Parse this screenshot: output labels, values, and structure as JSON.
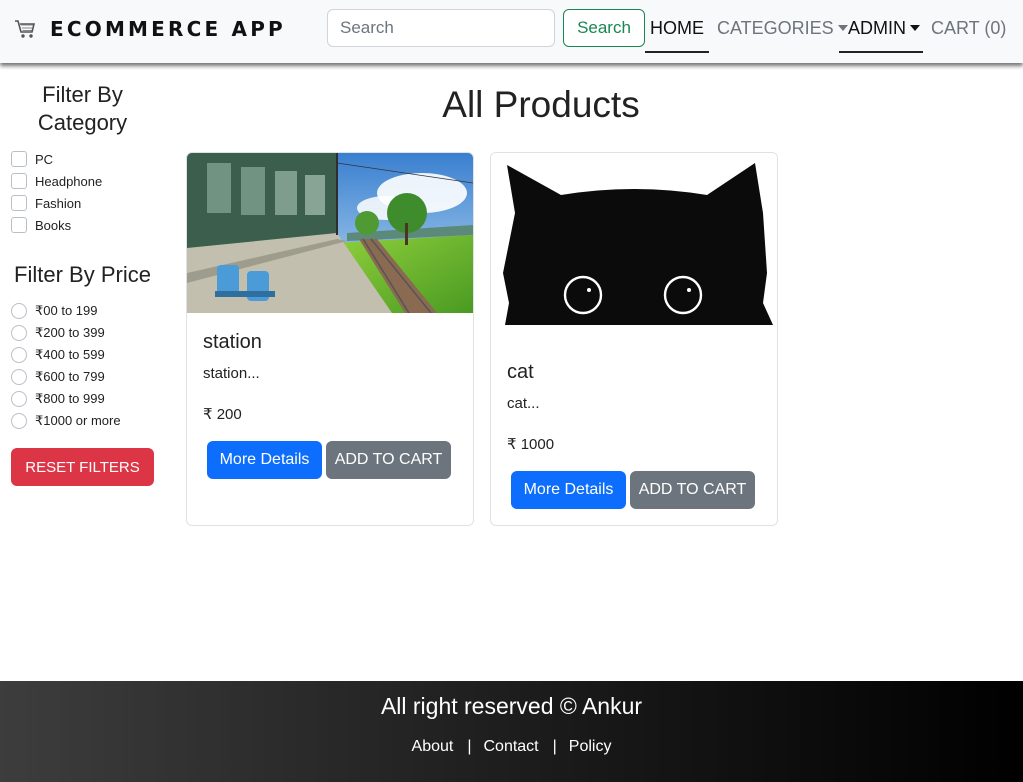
{
  "colors": {
    "navbar_bg": "#f8f9fa",
    "search_button": "#198754",
    "primary": "#0d6efd",
    "secondary": "#6c757d",
    "danger": "#dc3545",
    "footer_bg": "#1a1a1a"
  },
  "navbar": {
    "brand_icon": "shopping-cart-icon",
    "brand": "ECOMMERCE APP",
    "search_placeholder": "Search",
    "search_button": "Search",
    "links": {
      "home": "HOME",
      "categories": "CATEGORIES",
      "admin": "ADMIN",
      "cart": "CART (0)"
    },
    "active_link": "home"
  },
  "sidebar": {
    "category_heading": "Filter By Category",
    "categories": [
      "PC",
      "Headphone",
      "Fashion",
      "Books"
    ],
    "price_heading": "Filter By Price",
    "prices": [
      "₹00 to 199",
      "₹200 to 399",
      "₹400 to 599",
      "₹600 to 799",
      "₹800 to 999",
      "₹1000 or more"
    ],
    "reset_button": "RESET FILTERS"
  },
  "main": {
    "title": "All Products",
    "products": [
      {
        "name": "station",
        "description": "station...",
        "price": "₹ 200",
        "details_button": "More Details",
        "cart_button": "ADD TO CART",
        "image": "train-station-illustration"
      },
      {
        "name": "cat",
        "description": "cat...",
        "price": "₹ 1000",
        "details_button": "More Details",
        "cart_button": "ADD TO CART",
        "image": "black-cat-peeking-illustration"
      }
    ]
  },
  "footer": {
    "text": "All right reserved © Ankur",
    "links": [
      "About",
      "Contact",
      "Policy"
    ],
    "separator": "|"
  }
}
